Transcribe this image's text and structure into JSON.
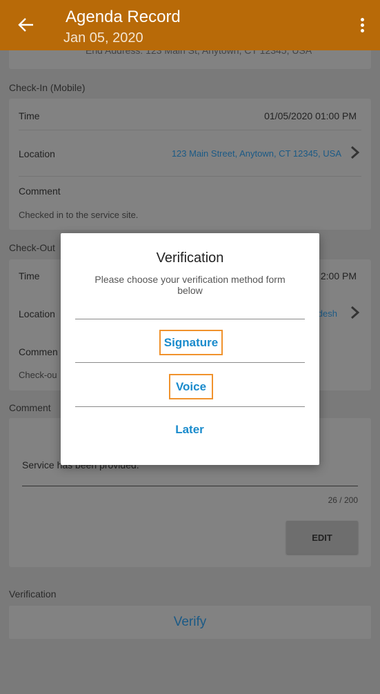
{
  "header": {
    "title": "Agenda Record",
    "date": "Jan 05, 2020",
    "back_icon": "arrow-left-icon",
    "menu_icon": "more-vert-icon"
  },
  "top_card": {
    "end_address_text": "End Address: 123 Main St, Anytown, CT 12345, USA"
  },
  "check_in": {
    "section_label": "Check-In (Mobile)",
    "time_label": "Time",
    "time_value": "01/05/2020 01:00 PM",
    "location_label": "Location",
    "location_value": "123 Main Street, Anytown, CT 12345, USA",
    "comment_label": "Comment",
    "comment_value": "Checked in to the service site."
  },
  "check_out": {
    "section_label": "Check-Out",
    "time_label": "Time",
    "time_value_partial": "2:00 PM",
    "location_label": "Location",
    "location_value_partial": "desh",
    "comment_label": "Commen",
    "comment_value_partial": "Check-ou"
  },
  "comment_section": {
    "label": "Comment",
    "text": "Service has been provided.",
    "counter": "26 / 200",
    "edit_label": "EDIT"
  },
  "verification_section": {
    "label": "Verification",
    "verify_label": "Verify"
  },
  "dialog": {
    "title": "Verification",
    "message": "Please choose your verification method form below",
    "options": [
      "Signature",
      "Voice",
      "Later"
    ]
  },
  "colors": {
    "header_bg": "#b86a08",
    "accent_blue": "#1a8bcc",
    "highlight_orange": "#f0922c"
  }
}
